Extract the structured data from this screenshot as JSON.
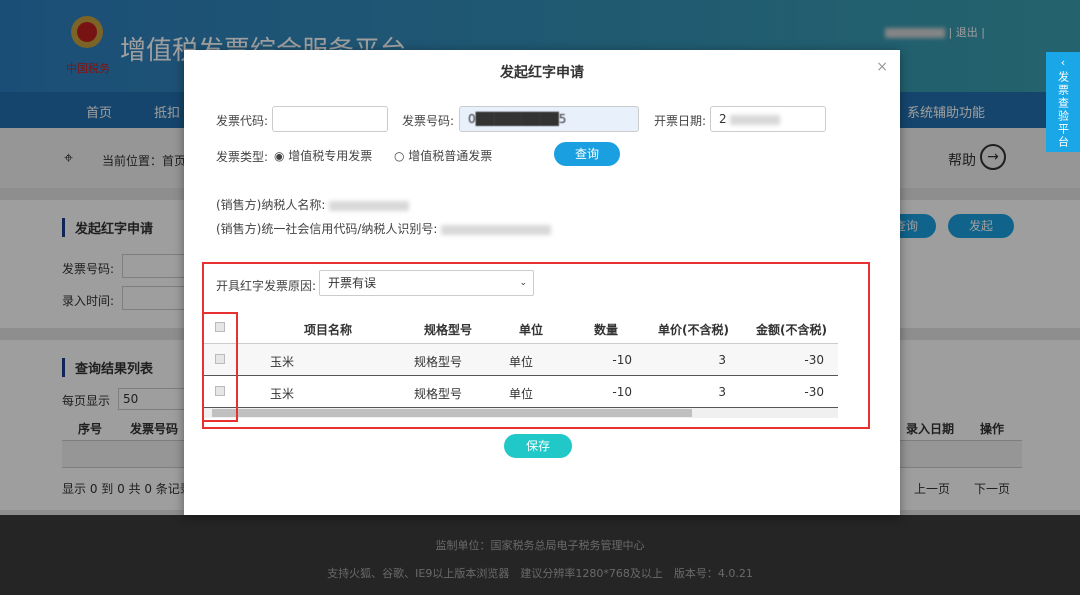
{
  "header": {
    "site_title": "增值税发票综合服务平台",
    "logo_text": "中国税务",
    "logout": "退出"
  },
  "nav": {
    "items": [
      "首页",
      "抵扣",
      "系统辅助功能"
    ]
  },
  "breadcrumb": {
    "label": "当前位置：首页",
    "help": "帮助"
  },
  "search_card": {
    "title": "发起红字申请",
    "invoice_no_label": "发票号码:",
    "entry_time_label": "录入时间:",
    "query_button": "查询",
    "launch_button": "发起"
  },
  "results": {
    "title": "查询结果列表",
    "per_page_label": "每页显示",
    "per_page_value": "50",
    "columns": [
      "序号",
      "发票号码",
      "录入日期",
      "操作"
    ],
    "summary": "显示 0 到 0 共 0 条记录",
    "prev": "上一页",
    "next": "下一页"
  },
  "footer": {
    "line1": "监制单位：国家税务总局电子税务管理中心",
    "line2": "支持火狐、谷歌、IE9以上版本浏览器　建议分辨率1280*768及以上　版本号：4.0.21"
  },
  "side_tab": {
    "label": "发票查验平台"
  },
  "dialog": {
    "title": "发起红字申请",
    "close": "×",
    "invoice_code_label": "发票代码:",
    "invoice_code_value": "",
    "invoice_no_label": "发票号码:",
    "invoice_no_value": "0█████████5",
    "issue_date_label": "开票日期:",
    "issue_date_value": "2",
    "type_label": "发票类型:",
    "type_options": [
      "增值税专用发票",
      "增值税普通发票"
    ],
    "type_selected": "增值税专用发票",
    "query_button": "查询",
    "seller_name_label": "(销售方)纳税人名称:",
    "seller_id_label": "(销售方)统一社会信用代码/纳税人识别号:",
    "reason_label": "开具红字发票原因:",
    "reason_value": "开票有误",
    "columns": [
      "项目名称",
      "规格型号",
      "单位",
      "数量",
      "单价(不含税)",
      "金额(不含税)"
    ],
    "rows": [
      {
        "name": "玉米",
        "spec": "规格型号",
        "unit": "单位",
        "qty": "-10",
        "price": "3",
        "amount": "-30"
      },
      {
        "name": "玉米",
        "spec": "规格型号",
        "unit": "单位",
        "qty": "-10",
        "price": "3",
        "amount": "-30"
      }
    ],
    "save_button": "保存",
    "highlight_color": "#e83030"
  }
}
